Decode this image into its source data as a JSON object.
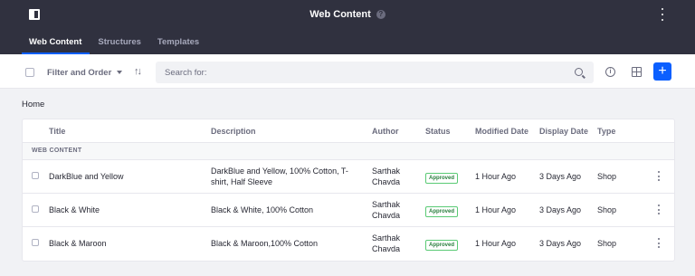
{
  "header": {
    "title": "Web Content",
    "help_symbol": "?"
  },
  "tabs": [
    {
      "label": "Web Content",
      "active": true
    },
    {
      "label": "Structures",
      "active": false
    },
    {
      "label": "Templates",
      "active": false
    }
  ],
  "toolbar": {
    "filter_label": "Filter and Order",
    "sort_symbol": "↑↓",
    "search_placeholder": "Search for:",
    "info_symbol": "i",
    "add_symbol": "+"
  },
  "breadcrumb": "Home",
  "table": {
    "columns": [
      "Title",
      "Description",
      "Author",
      "Status",
      "Modified Date",
      "Display Date",
      "Type"
    ],
    "group_label": "WEB CONTENT",
    "rows": [
      {
        "title": "DarkBlue and Yellow",
        "description": "DarkBlue and Yellow, 100% Cotton, T-shirt, Half Sleeve",
        "author": "Sarthak Chavda",
        "status": "Approved",
        "modified": "1 Hour Ago",
        "display": "3 Days Ago",
        "type": "Shop"
      },
      {
        "title": "Black & White",
        "description": "Black & White, 100% Cotton",
        "author": "Sarthak Chavda",
        "status": "Approved",
        "modified": "1 Hour Ago",
        "display": "3 Days Ago",
        "type": "Shop"
      },
      {
        "title": "Black & Maroon",
        "description": "Black & Maroon,100% Cotton",
        "author": "Sarthak Chavda",
        "status": "Approved",
        "modified": "1 Hour Ago",
        "display": "3 Days Ago",
        "type": "Shop"
      }
    ]
  },
  "colors": {
    "header_bg": "#30313f",
    "accent": "#0b5fff",
    "approved": "#287d3c"
  }
}
